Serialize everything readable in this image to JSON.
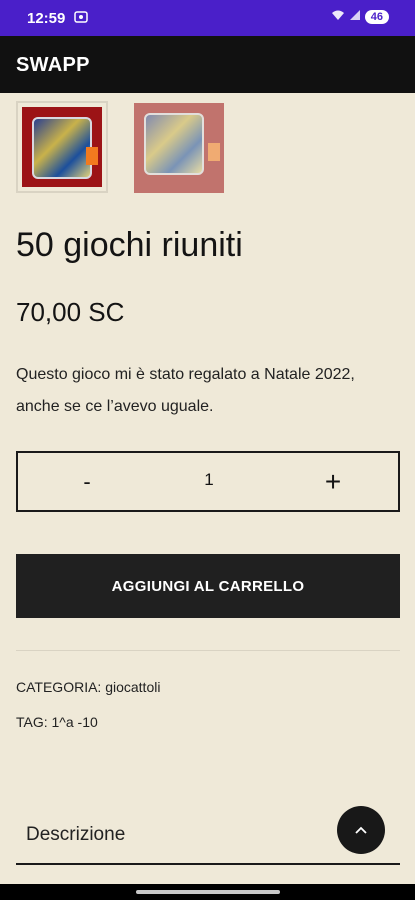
{
  "status_bar": {
    "time": "12:59",
    "battery": "46"
  },
  "app_bar": {
    "title": "SWAPP"
  },
  "product": {
    "title": "50 giochi riuniti",
    "price": "70,00 SC",
    "description": "Questo gioco mi è stato regalato a Natale 2022, anche se ce l’avevo uguale."
  },
  "quantity": {
    "minus": "-",
    "value": "1",
    "plus": "+"
  },
  "add_to_cart": "AGGIUNGI AL CARRELLO",
  "meta": {
    "category": "CATEGORIA: giocattoli",
    "tag": "TAG: 1^a -10"
  },
  "tabs": {
    "description": "Descrizione"
  },
  "colors": {
    "status_bar": "#4a1fc9",
    "app_bar": "#111111",
    "background": "#efe9d8",
    "button": "#202020"
  }
}
